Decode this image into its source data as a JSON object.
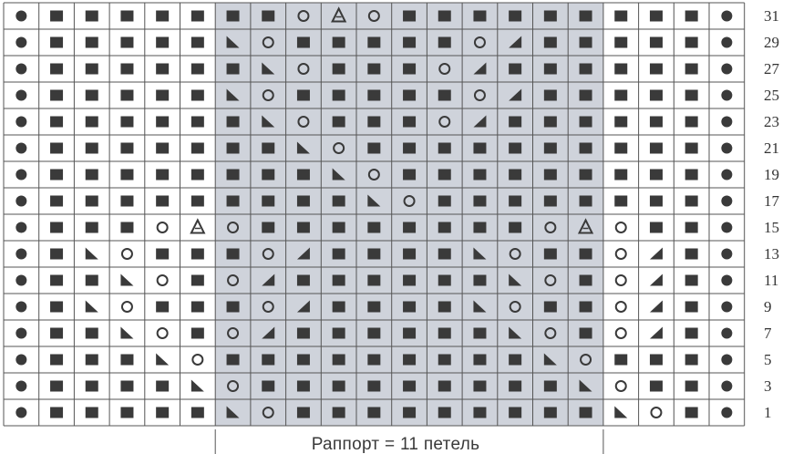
{
  "chart": {
    "columns": 21,
    "repeat_caption": "Раппорт = 11 петель",
    "repeat_columns": [
      6,
      16
    ],
    "colors": {
      "grid_line": "#555555",
      "repeat_fill": "#cfd3db",
      "symbol": "#3a3a3a",
      "background": "#ffffff"
    },
    "legend_codes": {
      "B": "bullet-dot",
      "S": "filled-square",
      "O": "yarn-over-circle",
      "L": "left-decrease-triangle",
      "R": "right-decrease-triangle",
      "T": "double-decrease-triangle"
    },
    "rows": [
      {
        "num": "31",
        "cells": "BSSSSSSSOTOSSSSSSSSSB"
      },
      {
        "num": "29",
        "cells": "BSSSSSLOSSSSSORSSSSSB"
      },
      {
        "num": "27",
        "cells": "BSSSSSSLOSSSORSSSSSSB"
      },
      {
        "num": "25",
        "cells": "BSSSSSLOSSSSSORSSSSSB"
      },
      {
        "num": "23",
        "cells": "BSSSSSSLOSSSORSSSSSSB"
      },
      {
        "num": "21",
        "cells": "BSSSSSSSLOSSSSSSSSSSB"
      },
      {
        "num": "19",
        "cells": "BSSSSSSSSLOSSSSSSSSSB"
      },
      {
        "num": "17",
        "cells": "BSSSSSSSSSLOSSSSSSSSB"
      },
      {
        "num": "15",
        "cells": "BSSSOTOSSSSSSSSOTOSSB"
      },
      {
        "num": "13",
        "cells": "BSLOSSSORSSSSLOSSORSB"
      },
      {
        "num": "11",
        "cells": "BSSLOSORSSSSSSLOSORSB"
      },
      {
        "num": "9",
        "cells": "BSLOSSSORSSSSLOSSORSB"
      },
      {
        "num": "7",
        "cells": "BSSLOSORSSSSSSLOSORSB"
      },
      {
        "num": "5",
        "cells": "BSSSLOSSSSSSSSSLOSSSB"
      },
      {
        "num": "3",
        "cells": "BSSSSLOSSSSSSSSSLOSSB"
      },
      {
        "num": "1",
        "cells": "BSSSSSLOSSSSSSSSSLOSB"
      }
    ]
  }
}
